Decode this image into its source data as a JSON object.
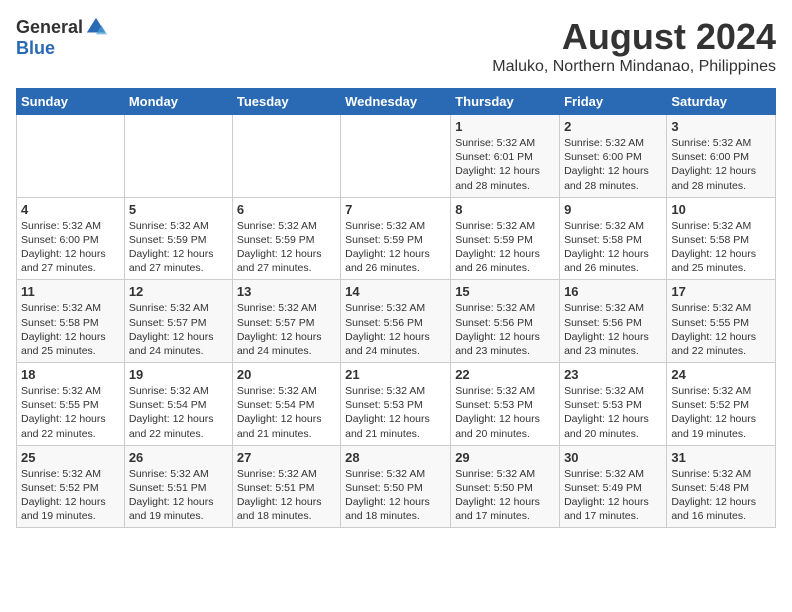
{
  "header": {
    "logo_general": "General",
    "logo_blue": "Blue",
    "main_title": "August 2024",
    "subtitle": "Maluko, Northern Mindanao, Philippines"
  },
  "weekdays": [
    "Sunday",
    "Monday",
    "Tuesday",
    "Wednesday",
    "Thursday",
    "Friday",
    "Saturday"
  ],
  "weeks": [
    [
      {
        "day": "",
        "info": ""
      },
      {
        "day": "",
        "info": ""
      },
      {
        "day": "",
        "info": ""
      },
      {
        "day": "",
        "info": ""
      },
      {
        "day": "1",
        "info": "Sunrise: 5:32 AM\nSunset: 6:01 PM\nDaylight: 12 hours\nand 28 minutes."
      },
      {
        "day": "2",
        "info": "Sunrise: 5:32 AM\nSunset: 6:00 PM\nDaylight: 12 hours\nand 28 minutes."
      },
      {
        "day": "3",
        "info": "Sunrise: 5:32 AM\nSunset: 6:00 PM\nDaylight: 12 hours\nand 28 minutes."
      }
    ],
    [
      {
        "day": "4",
        "info": "Sunrise: 5:32 AM\nSunset: 6:00 PM\nDaylight: 12 hours\nand 27 minutes."
      },
      {
        "day": "5",
        "info": "Sunrise: 5:32 AM\nSunset: 5:59 PM\nDaylight: 12 hours\nand 27 minutes."
      },
      {
        "day": "6",
        "info": "Sunrise: 5:32 AM\nSunset: 5:59 PM\nDaylight: 12 hours\nand 27 minutes."
      },
      {
        "day": "7",
        "info": "Sunrise: 5:32 AM\nSunset: 5:59 PM\nDaylight: 12 hours\nand 26 minutes."
      },
      {
        "day": "8",
        "info": "Sunrise: 5:32 AM\nSunset: 5:59 PM\nDaylight: 12 hours\nand 26 minutes."
      },
      {
        "day": "9",
        "info": "Sunrise: 5:32 AM\nSunset: 5:58 PM\nDaylight: 12 hours\nand 26 minutes."
      },
      {
        "day": "10",
        "info": "Sunrise: 5:32 AM\nSunset: 5:58 PM\nDaylight: 12 hours\nand 25 minutes."
      }
    ],
    [
      {
        "day": "11",
        "info": "Sunrise: 5:32 AM\nSunset: 5:58 PM\nDaylight: 12 hours\nand 25 minutes."
      },
      {
        "day": "12",
        "info": "Sunrise: 5:32 AM\nSunset: 5:57 PM\nDaylight: 12 hours\nand 24 minutes."
      },
      {
        "day": "13",
        "info": "Sunrise: 5:32 AM\nSunset: 5:57 PM\nDaylight: 12 hours\nand 24 minutes."
      },
      {
        "day": "14",
        "info": "Sunrise: 5:32 AM\nSunset: 5:56 PM\nDaylight: 12 hours\nand 24 minutes."
      },
      {
        "day": "15",
        "info": "Sunrise: 5:32 AM\nSunset: 5:56 PM\nDaylight: 12 hours\nand 23 minutes."
      },
      {
        "day": "16",
        "info": "Sunrise: 5:32 AM\nSunset: 5:56 PM\nDaylight: 12 hours\nand 23 minutes."
      },
      {
        "day": "17",
        "info": "Sunrise: 5:32 AM\nSunset: 5:55 PM\nDaylight: 12 hours\nand 22 minutes."
      }
    ],
    [
      {
        "day": "18",
        "info": "Sunrise: 5:32 AM\nSunset: 5:55 PM\nDaylight: 12 hours\nand 22 minutes."
      },
      {
        "day": "19",
        "info": "Sunrise: 5:32 AM\nSunset: 5:54 PM\nDaylight: 12 hours\nand 22 minutes."
      },
      {
        "day": "20",
        "info": "Sunrise: 5:32 AM\nSunset: 5:54 PM\nDaylight: 12 hours\nand 21 minutes."
      },
      {
        "day": "21",
        "info": "Sunrise: 5:32 AM\nSunset: 5:53 PM\nDaylight: 12 hours\nand 21 minutes."
      },
      {
        "day": "22",
        "info": "Sunrise: 5:32 AM\nSunset: 5:53 PM\nDaylight: 12 hours\nand 20 minutes."
      },
      {
        "day": "23",
        "info": "Sunrise: 5:32 AM\nSunset: 5:53 PM\nDaylight: 12 hours\nand 20 minutes."
      },
      {
        "day": "24",
        "info": "Sunrise: 5:32 AM\nSunset: 5:52 PM\nDaylight: 12 hours\nand 19 minutes."
      }
    ],
    [
      {
        "day": "25",
        "info": "Sunrise: 5:32 AM\nSunset: 5:52 PM\nDaylight: 12 hours\nand 19 minutes."
      },
      {
        "day": "26",
        "info": "Sunrise: 5:32 AM\nSunset: 5:51 PM\nDaylight: 12 hours\nand 19 minutes."
      },
      {
        "day": "27",
        "info": "Sunrise: 5:32 AM\nSunset: 5:51 PM\nDaylight: 12 hours\nand 18 minutes."
      },
      {
        "day": "28",
        "info": "Sunrise: 5:32 AM\nSunset: 5:50 PM\nDaylight: 12 hours\nand 18 minutes."
      },
      {
        "day": "29",
        "info": "Sunrise: 5:32 AM\nSunset: 5:50 PM\nDaylight: 12 hours\nand 17 minutes."
      },
      {
        "day": "30",
        "info": "Sunrise: 5:32 AM\nSunset: 5:49 PM\nDaylight: 12 hours\nand 17 minutes."
      },
      {
        "day": "31",
        "info": "Sunrise: 5:32 AM\nSunset: 5:48 PM\nDaylight: 12 hours\nand 16 minutes."
      }
    ]
  ]
}
